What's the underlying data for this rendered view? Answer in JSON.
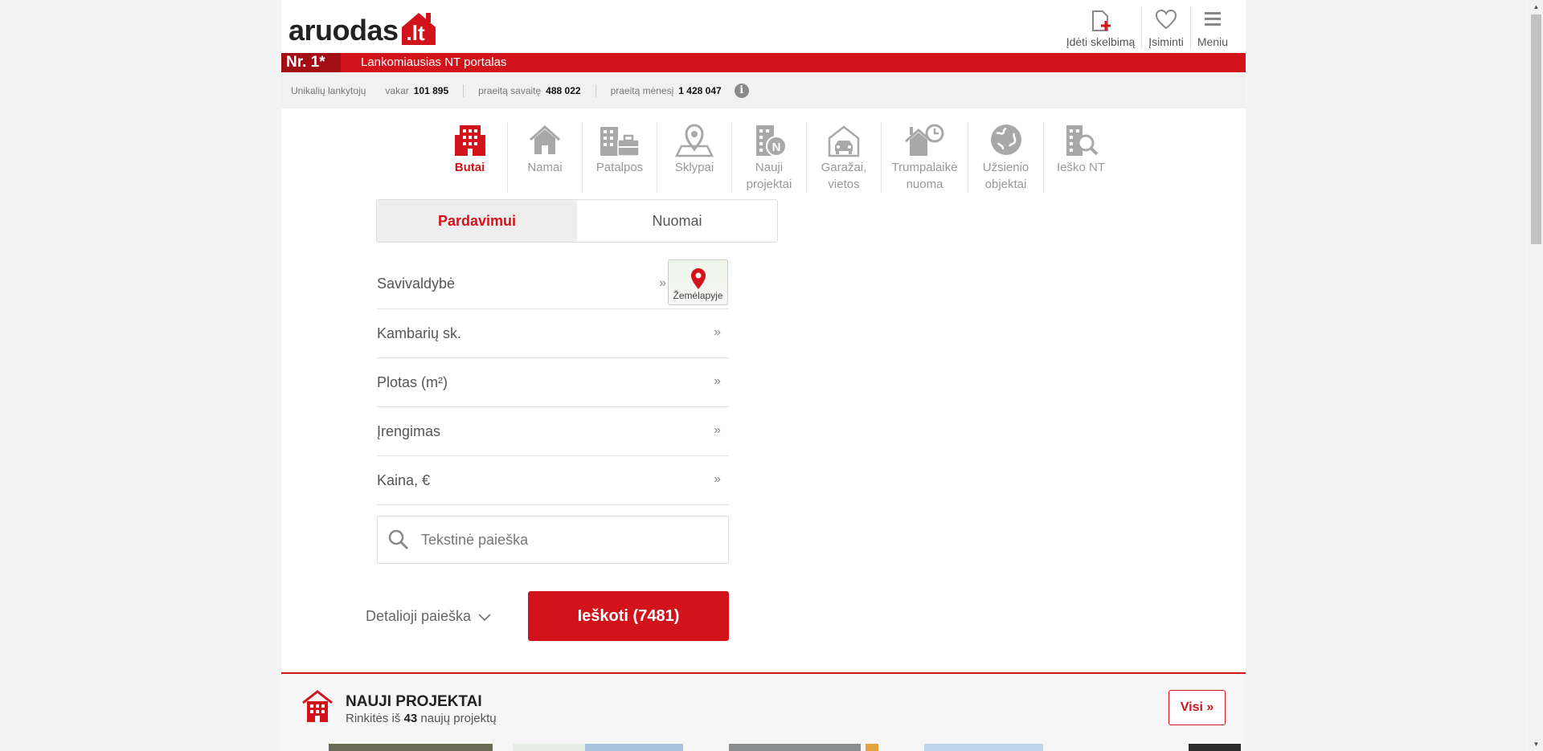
{
  "header": {
    "logo_word": "aruodas",
    "logo_tld": ".lt",
    "actions": {
      "add_listing": "Įdėti skelbimą",
      "remember": "Įsiminti",
      "menu": "Meniu"
    }
  },
  "banner": {
    "rank": "Nr. 1*",
    "slogan": "Lankomiausias NT portalas"
  },
  "stats": {
    "label": "Unikalių lankytojų",
    "yesterday_label": "vakar",
    "yesterday_value": "101 895",
    "week_label": "praeitą savaitę",
    "week_value": "488 022",
    "month_label": "praeitą mėnesį",
    "month_value": "1 428 047",
    "info_glyph": "i"
  },
  "categories": [
    {
      "label": "Butai",
      "icon": "apartment-building-icon",
      "active": true
    },
    {
      "label": "Namai",
      "icon": "house-icon",
      "active": false
    },
    {
      "label": "Patalpos",
      "icon": "office-briefcase-icon",
      "active": false
    },
    {
      "label": "Sklypai",
      "icon": "land-plot-pin-icon",
      "active": false
    },
    {
      "label": "Nauji projektai",
      "icon": "new-project-building-icon",
      "active": false
    },
    {
      "label": "Garažai, vietos",
      "icon": "garage-car-icon",
      "active": false
    },
    {
      "label": "Trumpalaikė nuoma",
      "icon": "house-clock-icon",
      "active": false
    },
    {
      "label": "Užsienio objektai",
      "icon": "globe-icon",
      "active": false
    },
    {
      "label": "Ieško NT",
      "icon": "building-search-icon",
      "active": false
    }
  ],
  "tabs": {
    "sale": "Pardavimui",
    "rent": "Nuomai"
  },
  "filters": {
    "municipality": "Savivaldybė",
    "map_button": "Žemėlapyje",
    "rooms": "Kambarių sk.",
    "area": "Plotas (m²)",
    "fitting": "Įrengimas",
    "price": "Kaina, €",
    "chevron": "»"
  },
  "search": {
    "placeholder": "Tekstinė paieška",
    "detailed_label": "Detalioji paieška",
    "button_label": "Ieškoti (7481)"
  },
  "new_projects": {
    "title": "NAUJI PROJEKTAI",
    "subtitle_prefix": "Rinkitės iš",
    "count": "43",
    "subtitle_suffix": "naujų projektų",
    "all_button": "Visi »"
  },
  "colors": {
    "brand_red": "#d3131b",
    "dark_red": "#a30e14",
    "inactive_icon": "#a8a8a8"
  }
}
